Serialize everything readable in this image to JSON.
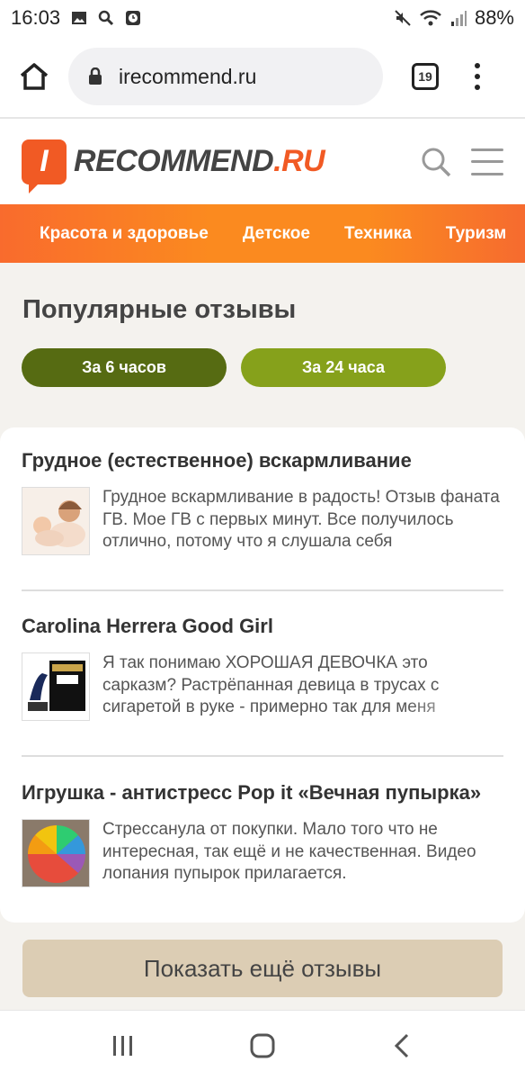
{
  "status_bar": {
    "time": "16:03",
    "battery": "88%",
    "icons": [
      "image-icon",
      "search-icon",
      "alarm-icon",
      "mute-icon",
      "wifi-icon",
      "signal-icon"
    ]
  },
  "browser": {
    "url": "irecommend.ru",
    "tab_count": "19"
  },
  "site": {
    "logo_letter": "I",
    "logo_main": "RECOMMEND",
    "logo_suffix": ".RU",
    "accent": "#f15a24"
  },
  "categories": [
    "Красота и здоровье",
    "Детское",
    "Техника",
    "Туризм"
  ],
  "popular": {
    "title": "Популярные отзывы",
    "filters": [
      {
        "label": "За 6 часов",
        "active": true
      },
      {
        "label": "За 24 часа",
        "active": false
      }
    ]
  },
  "reviews": [
    {
      "title": "Грудное (естественное) вскармливание",
      "text": "Грудное вскармливание в радость! Отзыв фаната ГВ. Мое ГВ с первых минут. Все получилось отлично, потому что я слушала себя",
      "thumb_icon": "mother-baby-photo"
    },
    {
      "title": "Carolina Herrera Good Girl",
      "text": "Я так понимаю ХОРОШАЯ ДЕВОЧКА это сарказм? Растрёпанная девица в трусах с сигаретой в руке - примерно так для меня",
      "thumb_icon": "perfume-photo"
    },
    {
      "title": "Игрушка - антистресс Pop it «Вечная пупырка»",
      "text": "Стрессанула от покупки. Мало того что не интересная, так ещё и не качественная. Видео лопания пупырок прилагается.",
      "thumb_icon": "pop-it-photo"
    }
  ],
  "show_more": "Показать ещё отзывы",
  "colors": {
    "pill_active": "#566b12",
    "pill_inactive": "#86a11b",
    "show_more_bg": "#dccdb4"
  }
}
